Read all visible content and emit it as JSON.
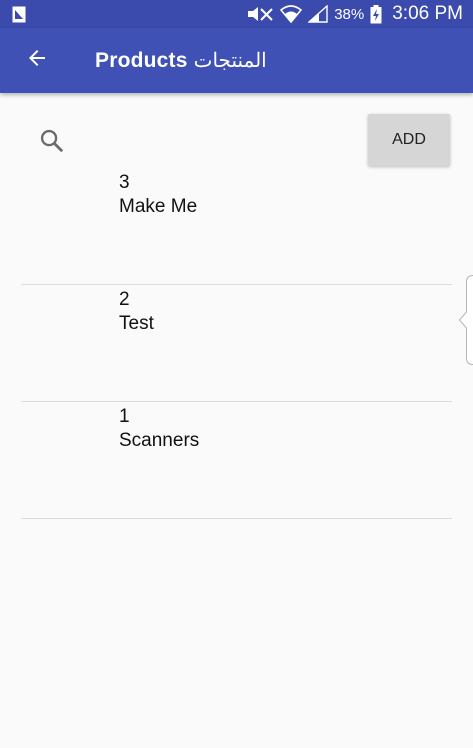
{
  "status_bar": {
    "battery_percent": "38%",
    "time": "3:06 PM",
    "icons": [
      "sim-card-icon",
      "mute-icon",
      "wifi-icon",
      "signal-icon",
      "battery-charging-icon"
    ]
  },
  "app_bar": {
    "back_icon": "arrow-back-icon",
    "title": "Products",
    "title_ar": "المنتجات",
    "color": "#3f51b5"
  },
  "search": {
    "icon": "search-icon",
    "value": "",
    "placeholder": ""
  },
  "toolbar": {
    "add_label": "ADD"
  },
  "products": [
    {
      "number": "3",
      "name": "Make Me"
    },
    {
      "number": "2",
      "name": "Test"
    },
    {
      "number": "1",
      "name": "Scanners"
    }
  ]
}
